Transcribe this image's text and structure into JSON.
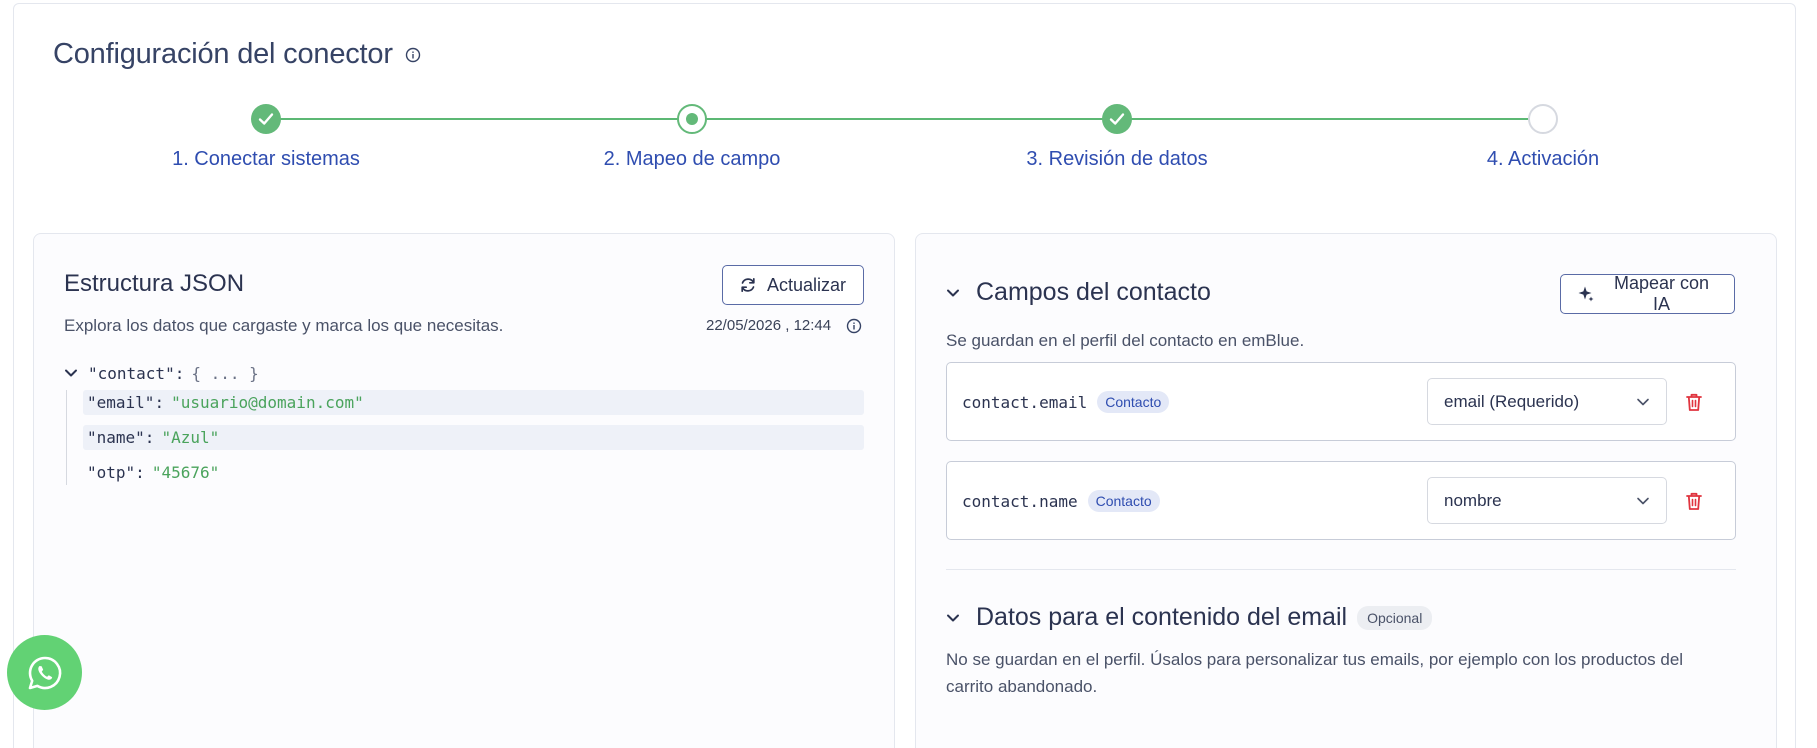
{
  "page": {
    "title": "Configuración del conector"
  },
  "stepper": {
    "steps": [
      {
        "label": "1. Conectar sistemas",
        "state": "done"
      },
      {
        "label": "2. Mapeo de campo",
        "state": "current"
      },
      {
        "label": "3. Revisión de datos",
        "state": "done"
      },
      {
        "label": "4. Activación",
        "state": "todo"
      }
    ]
  },
  "json_panel": {
    "title": "Estructura JSON",
    "subtitle": "Explora los datos que cargaste y marca los que necesitas.",
    "refresh_label": "Actualizar",
    "timestamp": "22/05/2026 , 12:44",
    "tree": {
      "root_key": "\"contact\"",
      "root_collapsed": "{ ... }",
      "children": [
        {
          "key": "\"email\"",
          "value": "\"usuario@domain.com\""
        },
        {
          "key": "\"name\"",
          "value": "\"Azul\""
        },
        {
          "key": "\"otp\"",
          "value": "\"45676\""
        }
      ]
    }
  },
  "contact_panel": {
    "title": "Campos del contacto",
    "ai_button_label": "Mapear con IA",
    "description": "Se guardan en el perfil del contacto en emBlue.",
    "fields": [
      {
        "key": "contact.email",
        "badge": "Contacto",
        "selected": "email (Requerido)"
      },
      {
        "key": "contact.name",
        "badge": "Contacto",
        "selected": "nombre"
      }
    ]
  },
  "email_panel": {
    "title": "Datos para el contenido del email",
    "badge": "Opcional",
    "description": "No se guardan en el perfil. Úsalos para personalizar tus emails, por ejemplo con los productos del carrito abandonado."
  },
  "colors": {
    "accent_blue": "#2f4db0",
    "success_green": "#63b979",
    "danger_red": "#e0343f",
    "whatsapp_green": "#62d274"
  }
}
